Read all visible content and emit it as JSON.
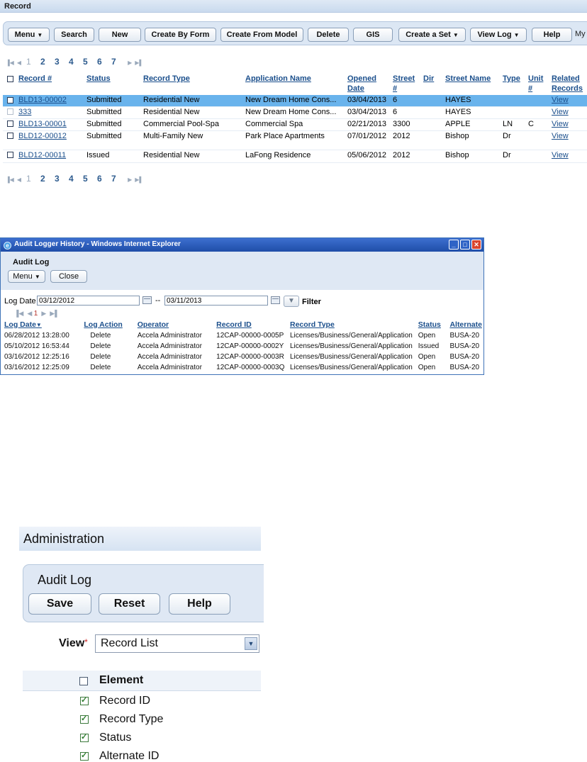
{
  "record_panel": {
    "title": "Record",
    "toolbar": [
      {
        "label": "Menu",
        "dropdown": true
      },
      {
        "label": "Search",
        "dropdown": false
      },
      {
        "label": "New",
        "dropdown": false
      },
      {
        "label": "Create By Form",
        "dropdown": false
      },
      {
        "label": "Create From Model",
        "dropdown": false
      },
      {
        "label": "Delete",
        "dropdown": false
      },
      {
        "label": "GIS",
        "dropdown": false
      },
      {
        "label": "Create a Set",
        "dropdown": true
      },
      {
        "label": "View Log",
        "dropdown": true
      },
      {
        "label": "Help",
        "dropdown": false
      }
    ],
    "toolbar_trailing_text": "My",
    "pages": [
      "1",
      "2",
      "3",
      "4",
      "5",
      "6",
      "7"
    ],
    "current_page": "1",
    "columns": [
      "Record #",
      "Status",
      "Record Type",
      "Application Name",
      "Opened Date",
      "Street #",
      "Dir",
      "Street Name",
      "Type",
      "Unit #",
      "Related Records"
    ],
    "rows": [
      {
        "record": "BLD13-00002",
        "status": "Submitted",
        "type": "Residential New",
        "app": "New Dream Home Cons...",
        "opened": "03/04/2013",
        "street_no": "6",
        "dir": "",
        "street": "HAYES",
        "stype": "",
        "unit": "",
        "related": "View",
        "selected": true
      },
      {
        "record": "333",
        "status": "Submitted",
        "type": "Residential New",
        "app": "New Dream Home Cons...",
        "opened": "03/04/2013",
        "street_no": "6",
        "dir": "",
        "street": "HAYES",
        "stype": "",
        "unit": "",
        "related": "View",
        "selected": false
      },
      {
        "record": "BLD13-00001",
        "status": "Submitted",
        "type": "Commercial Pool-Spa",
        "app": "Commercial Spa",
        "opened": "02/21/2013",
        "street_no": "3300",
        "dir": "",
        "street": "APPLE",
        "stype": "LN",
        "unit": "C",
        "related": "View",
        "selected": false
      },
      {
        "record": "BLD12-00012",
        "status": "Submitted",
        "type": "Multi-Family New",
        "app": "Park Place Apartments",
        "opened": "07/01/2012",
        "street_no": "2012",
        "dir": "",
        "street": "Bishop",
        "stype": "Dr",
        "unit": "",
        "related": "View",
        "selected": false
      },
      {
        "record": "BLD12-00011",
        "status": "Issued",
        "type": "Residential New",
        "app": "LaFong Residence",
        "opened": "05/06/2012",
        "street_no": "2012",
        "dir": "",
        "street": "Bishop",
        "stype": "Dr",
        "unit": "",
        "related": "View",
        "selected": false
      }
    ]
  },
  "audit_window": {
    "window_title": "Audit Logger History - Windows Internet Explorer",
    "heading": "Audit Log",
    "menu_label": "Menu",
    "close_label": "Close",
    "log_date_label": "Log Date",
    "date_from": "03/12/2012",
    "date_sep": "--",
    "date_to": "03/11/2013",
    "filter_label": "Filter",
    "current_page": "1",
    "columns": [
      "Log Date",
      "Log Action",
      "Operator",
      "Record ID",
      "Record Type",
      "Status",
      "Alternate"
    ],
    "rows": [
      [
        "06/28/2012 13:28:00",
        "Delete",
        "Accela Administrator",
        "12CAP-00000-0005P",
        "Licenses/Business/General/Application",
        "Open",
        "BUSA-20"
      ],
      [
        "05/10/2012 16:53:44",
        "Delete",
        "Accela Administrator",
        "12CAP-00000-0002Y",
        "Licenses/Business/General/Application",
        "Issued",
        "BUSA-20"
      ],
      [
        "03/16/2012 12:25:16",
        "Delete",
        "Accela Administrator",
        "12CAP-00000-0003R",
        "Licenses/Business/General/Application",
        "Open",
        "BUSA-20"
      ],
      [
        "03/16/2012 12:25:09",
        "Delete",
        "Accela Administrator",
        "12CAP-00000-0003Q",
        "Licenses/Business/General/Application",
        "Open",
        "BUSA-20"
      ]
    ]
  },
  "admin_panel": {
    "title": "Administration",
    "heading": "Audit Log",
    "buttons": [
      "Save",
      "Reset",
      "Help"
    ],
    "view_label": "View",
    "required_mark": "*",
    "view_value": "Record List",
    "element_header": "Element",
    "elements": [
      {
        "label": "Record ID",
        "checked": true
      },
      {
        "label": "Record Type",
        "checked": true
      },
      {
        "label": "Status",
        "checked": true
      },
      {
        "label": "Alternate ID",
        "checked": true
      }
    ]
  }
}
